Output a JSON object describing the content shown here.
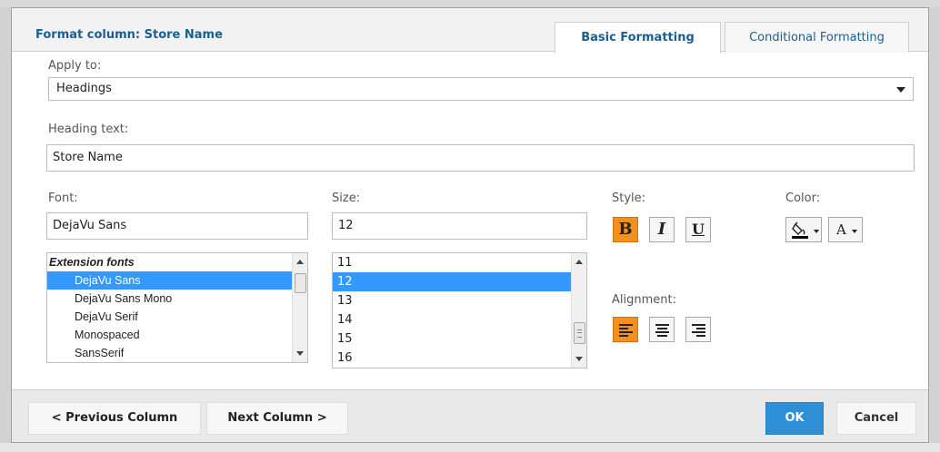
{
  "dialog": {
    "title": "Format column: Store Name",
    "tabs": [
      {
        "label": "Basic Formatting",
        "active": true
      },
      {
        "label": "Conditional Formatting",
        "active": false
      }
    ]
  },
  "apply_to": {
    "label": "Apply to:",
    "value": "Headings"
  },
  "heading": {
    "label": "Heading text:",
    "value": "Store Name"
  },
  "font": {
    "label": "Font:",
    "value": "DejaVu Sans",
    "list": [
      {
        "label": "Extension fonts",
        "group": true
      },
      {
        "label": "DejaVu Sans",
        "selected": true
      },
      {
        "label": "DejaVu Sans Mono"
      },
      {
        "label": "DejaVu Serif"
      },
      {
        "label": "Monospaced"
      },
      {
        "label": "SansSerif"
      }
    ]
  },
  "size": {
    "label": "Size:",
    "value": "12",
    "list": [
      {
        "label": "11"
      },
      {
        "label": "12",
        "selected": true
      },
      {
        "label": "13"
      },
      {
        "label": "14"
      },
      {
        "label": "15"
      },
      {
        "label": "16"
      }
    ]
  },
  "style": {
    "label": "Style:",
    "bold": {
      "glyph": "B",
      "active": true
    },
    "italic": {
      "glyph": "I",
      "active": false
    },
    "underline": {
      "glyph": "U",
      "active": false
    }
  },
  "color": {
    "label": "Color:",
    "fill_icon": "paint-bucket-icon",
    "text_glyph": "A"
  },
  "alignment": {
    "label": "Alignment:",
    "value": "left",
    "options": [
      "align-left-icon",
      "align-center-icon",
      "align-right-icon"
    ]
  },
  "footer": {
    "prev_label": "< Previous Column",
    "next_label": "Next Column >",
    "ok_label": "OK",
    "cancel_label": "Cancel"
  },
  "colors": {
    "accent": "#f4901e",
    "title": "#1a5f8f",
    "ok": "#2f8fd6",
    "selection": "#3399ff"
  }
}
